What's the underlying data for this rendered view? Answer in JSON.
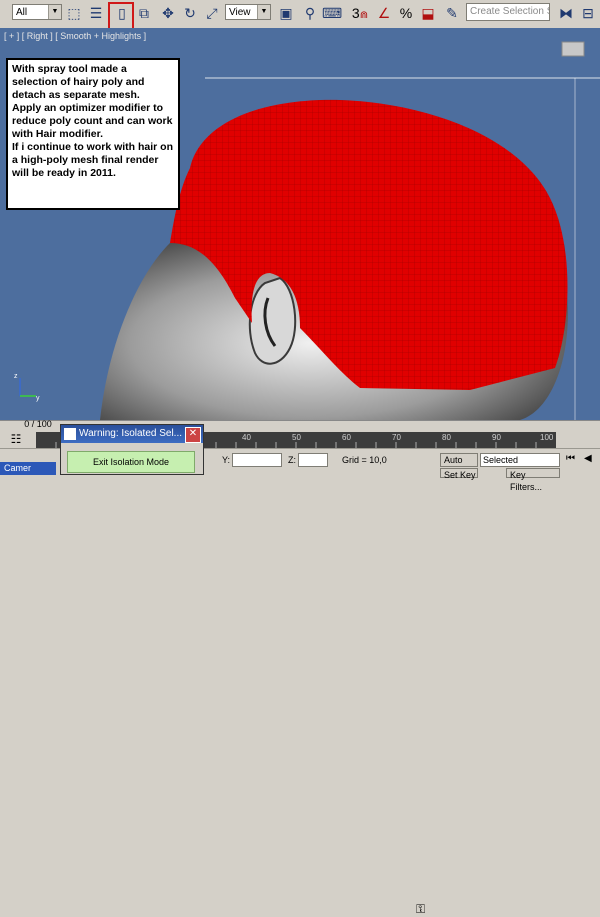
{
  "toolbar": {
    "selection_filter": "All",
    "coordinate_system": "View",
    "selection_set_placeholder": "Create Selection Se",
    "snap_toggle_label": "3",
    "percent_snap_label": "%",
    "icons": [
      "select-object-icon",
      "select-by-name-icon",
      "select-region-icon",
      "window-crossing-icon",
      "select-move-icon",
      "select-rotate-icon",
      "select-scale-icon",
      "pivot-icon",
      "manipulate-icon",
      "keyboard-shortcut-icon",
      "snap-icon",
      "angle-snap-icon",
      "percent-snap-icon",
      "spinner-snap-icon",
      "mirror-icon",
      "align-icon"
    ]
  },
  "viewport": {
    "label": "[ + ] [ Right ] [ Smooth + Highlights ]"
  },
  "note": {
    "text": "With spray tool made a selection of hairy poly and detach as separate mesh.\nApply an optimizer modifier to reduce poly count and can work with Hair modifier.\nIf i continue to work with hair on a high-poly mesh final render will be ready in 2011."
  },
  "timeline": {
    "frame_counter": "0 / 100",
    "ticks": [
      "40",
      "50",
      "60",
      "70",
      "80",
      "90",
      "100"
    ]
  },
  "warning_dialog": {
    "title": "Warning: Isolated Sel...",
    "button": "Exit Isolation Mode"
  },
  "status": {
    "y_label": "Y:",
    "z_label": "Z:",
    "grid": "Grid = 10,0",
    "auto_key": "Auto Key",
    "set_key": "Set Key",
    "selected": "Selected",
    "key_filters": "Key Filters...",
    "taskbar": "Camer"
  },
  "colors": {
    "viewport_bg": "#4d6e9e",
    "hair_mesh": "#e00000",
    "highlight": "#d01818"
  }
}
